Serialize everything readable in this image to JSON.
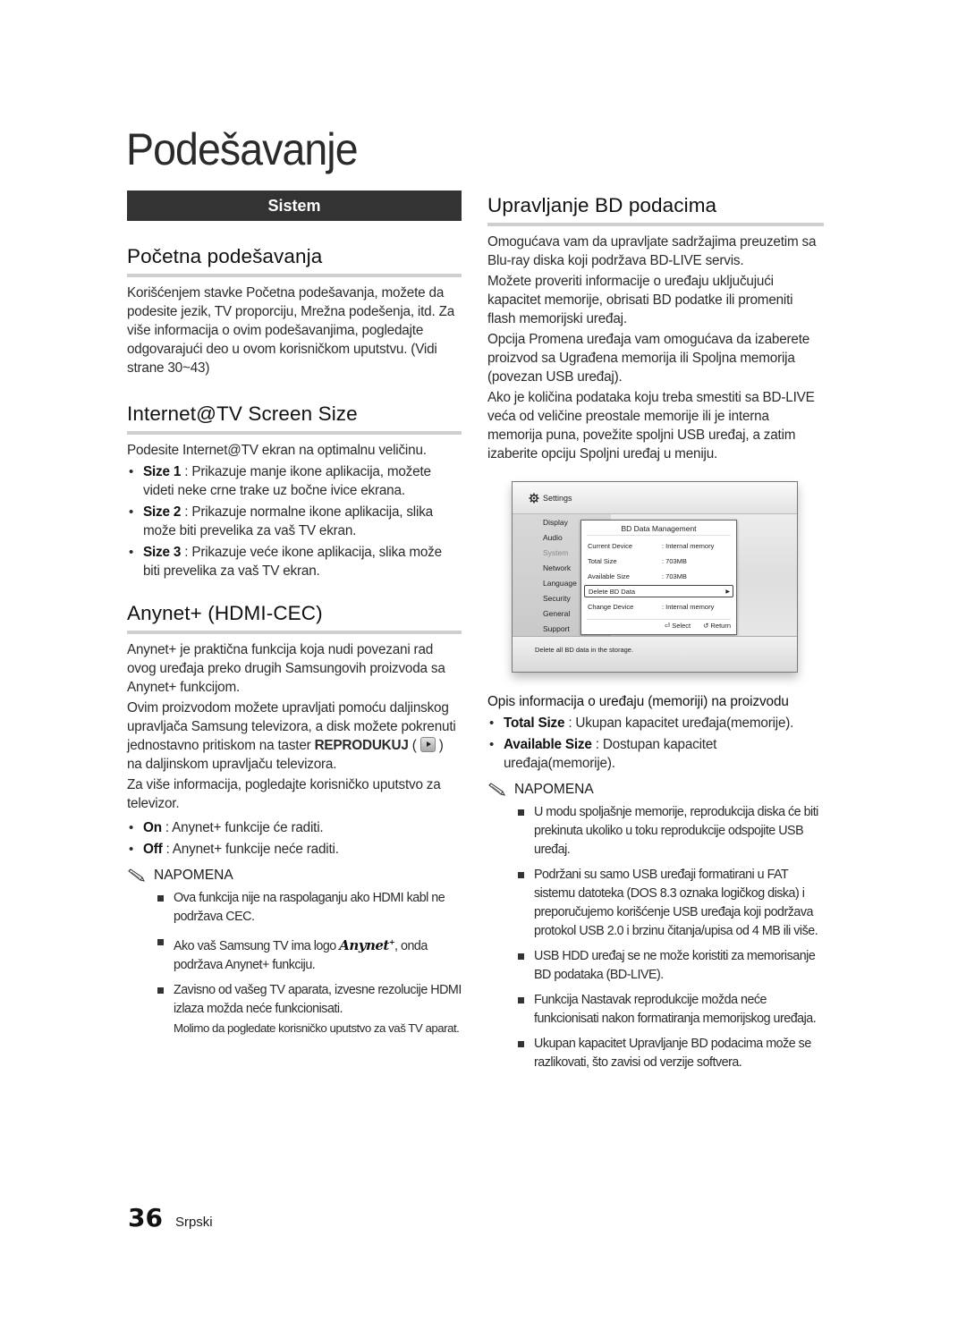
{
  "page": {
    "title": "Podešavanje",
    "page_number": "36",
    "language": "Srpski"
  },
  "left": {
    "section_bar": "Sistem",
    "pocetna": {
      "heading": "Početna podešavanja",
      "text": "Korišćenjem stavke Početna podešavanja, možete da podesite jezik, TV proporciju, Mrežna podešenja, itd. Za više informacija o ovim podešavanjima, pogledajte odgovarajući deo u ovom korisničkom uputstvu. (Vidi strane 30~43)"
    },
    "screen_size": {
      "heading": "Internet@TV Screen Size",
      "intro": "Podesite Internet@TV ekran na optimalnu veličinu.",
      "items": [
        {
          "term": "Size 1",
          "desc": " : Prikazuje manje ikone aplikacija, možete videti neke crne trake uz bočne ivice ekrana."
        },
        {
          "term": "Size 2",
          "desc": " : Prikazuje normalne ikone aplikacija, slika može biti prevelika za vaš TV ekran."
        },
        {
          "term": "Size 3",
          "desc": " : Prikazuje veće ikone aplikacija, slika može biti prevelika za vaš TV ekran."
        }
      ]
    },
    "anynet": {
      "heading": "Anynet+ (HDMI-CEC)",
      "para1": "Anynet+ je praktična funkcija koja nudi povezani rad ovog uređaja preko drugih Samsungovih proizvoda sa Anynet+ funkcijom.",
      "para2_before": "Ovim proizvodom možete upravljati pomoću daljinskog upravljača Samsung televizora, a disk možete pokrenuti jednostavno pritiskom na taster ",
      "para2_key": "REPRODUKUJ",
      "para2_open": " ( ",
      "para2_after": " ) na daljinskom upravljaču televizora.",
      "para3": "Za više informacija, pogledajte korisničko uputstvo za televizor.",
      "items": [
        {
          "term": "On",
          "desc": " : Anynet+ funkcije će raditi."
        },
        {
          "term": "Off",
          "desc": " : Anynet+ funkcije neće raditi."
        }
      ],
      "note_label": "NAPOMENA",
      "notes": {
        "n1": "Ova funkcija nije na raspolaganju ako HDMI kabl ne podržava CEC.",
        "n2_before": "Ako vaš Samsung TV ima logo ",
        "n2_logo": "Anynet",
        "n2_logo_sup": "+",
        "n2_after": ", onda podržava Anynet+ funkciju.",
        "n3": "Zavisno od vašeg TV aparata, izvesne rezolucije HDMI izlaza možda neće funkcionisati.",
        "n3_extra": "Molimo da pogledate korisničko uputstvo za vaš TV aparat."
      }
    }
  },
  "right": {
    "heading": "Upravljanje BD podacima",
    "paras": [
      "Omogućava vam da upravljate sadržajima preuzetim sa Blu-ray diska koji podržava BD-LIVE servis.",
      "Možete proveriti informacije o uređaju uključujući kapacitet memorije, obrisati BD podatke ili promeniti flash memorijski uređaj.",
      "Opcija Promena uređaja vam omogućava da izaberete proizvod sa Ugrađena memorija ili Spoljna memorija (povezan USB uređaj).",
      "Ako je količina podataka koju treba smestiti sa BD-LIVE veća od veličine preostale memorije ili je interna memorija puna, povežite spoljni USB uređaj, a zatim izaberite opciju Spoljni uređaj u meniju."
    ],
    "screen": {
      "header": "Settings",
      "menu": [
        "Display",
        "Audio",
        "System",
        "Network",
        "Language",
        "Security",
        "General",
        "Support"
      ],
      "menu_active": "System",
      "dialog_title": "BD Data Management",
      "rows": [
        {
          "key": "Current Device",
          "value": ": Internal memory"
        },
        {
          "key": "Total Size",
          "value": ": 703MB"
        },
        {
          "key": "Available Size",
          "value": ": 703MB"
        },
        {
          "key": "Delete BD Data",
          "value": ""
        },
        {
          "key": "Change Device",
          "value": ": Internal memory"
        }
      ],
      "selected_row": "Delete BD Data",
      "select_label": "Select",
      "return_label": "Return",
      "status": "Delete all BD data in the storage."
    },
    "info_heading": "Opis informacija o uređaju (memoriji) na proizvodu",
    "info_items": [
      {
        "term": "Total Size",
        "desc": " : Ukupan kapacitet uređaja(memorije)."
      },
      {
        "term": "Available Size",
        "desc": " : Dostupan kapacitet uređaja(memorije)."
      }
    ],
    "note_label": "NAPOMENA",
    "notes": [
      "U modu spoljašnje memorije, reprodukcija diska će biti prekinuta ukoliko u toku reprodukcije odspojite USB uređaj.",
      "Podržani su samo USB uređaji formatirani u FAT sistemu datoteka (DOS 8.3 oznaka logičkog diska) i preporučujemo korišćenje USB uređaja koji podržava protokol USB 2.0 i brzinu čitanja/upisa od 4 MB ili više.",
      "USB HDD uređaj se ne može koristiti za memorisanje BD podataka (BD-LIVE).",
      "Funkcija Nastavak reprodukcije možda neće funkcionisati nakon formatiranja memorijskog uređaja.",
      "Ukupan kapacitet Upravljanje BD podacima može se razlikovati, što zavisi od verzije softvera."
    ]
  }
}
